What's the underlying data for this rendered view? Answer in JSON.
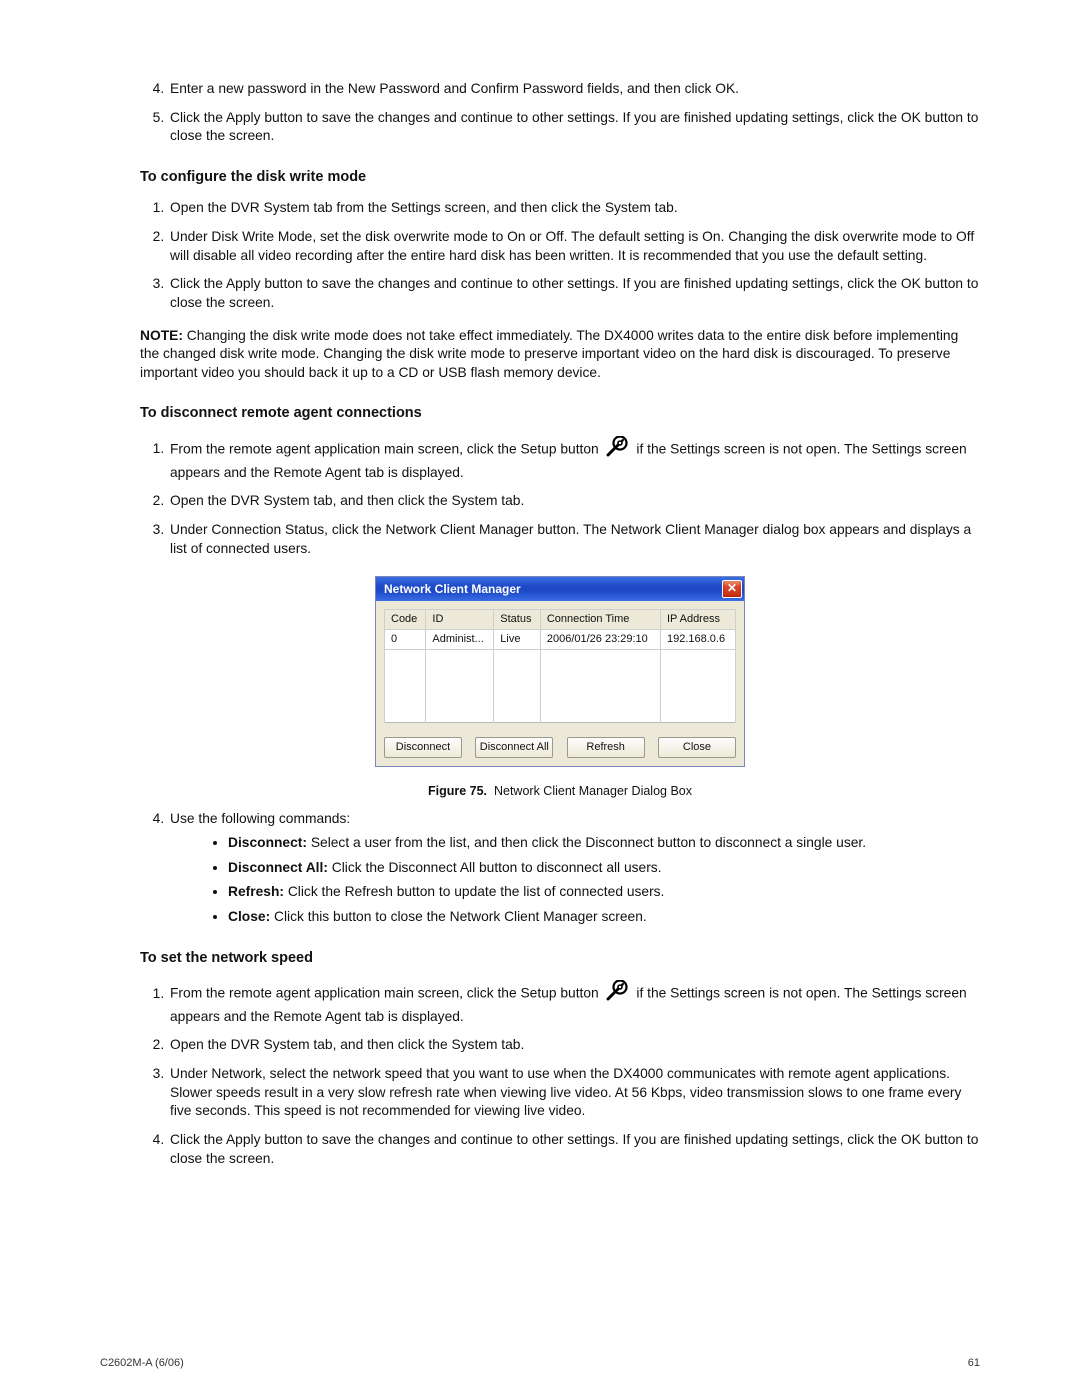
{
  "intro_steps_start": 4,
  "intro_steps": [
    "Enter a new password in the New Password and Confirm Password fields, and then click OK.",
    "Click the Apply button to save the changes and continue to other settings. If you are finished updating settings, click the OK button to close the screen."
  ],
  "section1": {
    "heading": "To configure the disk write mode",
    "steps": [
      "Open the DVR System tab from the Settings screen, and then click the System tab.",
      "Under Disk Write Mode, set the disk overwrite mode to On or Off. The default setting is On. Changing the disk overwrite mode to Off will disable all video recording after the entire hard disk has been written. It is recommended that you use the default setting.",
      "Click the Apply button to save the changes and continue to other settings. If you are finished updating settings, click the OK button to close the screen."
    ],
    "note_prefix": "NOTE:",
    "note_text": "Changing the disk write mode does not take effect immediately. The DX4000 writes data to the entire disk before implementing the changed disk write mode. Changing the disk write mode to preserve important video on the hard disk is discouraged. To preserve important video you should back it up to a CD or USB flash memory device."
  },
  "section2": {
    "heading": "To disconnect remote agent connections",
    "step1_pre": "From the remote agent application main screen, click the Setup button",
    "step1_post": "if the Settings screen is not open. The Settings screen appears and the Remote Agent tab is displayed.",
    "step2": "Open the DVR System tab, and then click the System tab.",
    "step3": "Under Connection Status, click the Network Client Manager button. The Network Client Manager dialog box appears and displays a list of connected users.",
    "step4": "Use the following commands:",
    "commands": [
      {
        "name": "Disconnect:",
        "text": "Select a user from the list, and then click the Disconnect button to disconnect a single user."
      },
      {
        "name": "Disconnect All:",
        "text": "Click the Disconnect All button to disconnect all users."
      },
      {
        "name": "Refresh:",
        "text": "Click the Refresh button to update the list of connected users."
      },
      {
        "name": "Close:",
        "text": "Click this button to close the Network Client Manager screen."
      }
    ]
  },
  "dialog": {
    "title": "Network Client Manager",
    "headers": [
      "Code",
      "ID",
      "Status",
      "Connection Time",
      "IP Address"
    ],
    "row": [
      "0",
      "Administ...",
      "Live",
      "2006/01/26 23:29:10",
      "192.168.0.6"
    ],
    "buttons": [
      "Disconnect",
      "Disconnect All",
      "Refresh",
      "Close"
    ],
    "caption_bold": "Figure 75.",
    "caption_rest": "Network Client Manager Dialog Box"
  },
  "section3": {
    "heading": "To set the network speed",
    "step1_pre": "From the remote agent application main screen, click the Setup button",
    "step1_post": "if the Settings screen is not open. The Settings screen appears and the Remote Agent tab is displayed.",
    "step2": "Open the DVR System tab, and then click the System tab.",
    "step3": "Under Network, select the network speed that you want to use when the DX4000 communicates with remote agent applications. Slower speeds result in a very slow refresh rate when viewing live video. At 56 Kbps, video transmission slows to one frame every five seconds. This speed is not recommended for viewing live video.",
    "step4": "Click the Apply button to save the changes and continue to other settings. If you are finished updating settings, click the OK button to close the screen."
  },
  "footer": {
    "left": "C2602M-A (6/06)",
    "right": "61"
  }
}
